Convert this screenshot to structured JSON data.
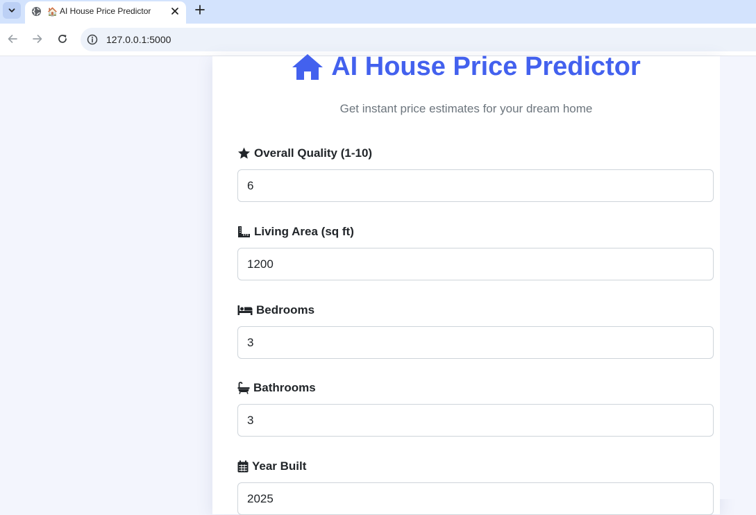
{
  "browser": {
    "tab": {
      "emoji": "🏠",
      "title": "AI House Price Predictor"
    },
    "url": "127.0.0.1:5000"
  },
  "header": {
    "icon": "home-icon",
    "title": "AI House Price Predictor",
    "subtitle": "Get instant price estimates for your dream home",
    "accent_color": "#4361ee"
  },
  "fields": [
    {
      "icon": "star-icon",
      "label": "Overall Quality (1-10)",
      "value": "6"
    },
    {
      "icon": "ruler-icon",
      "label": "Living Area (sq ft)",
      "value": "1200"
    },
    {
      "icon": "bed-icon",
      "label": "Bedrooms",
      "value": "3"
    },
    {
      "icon": "bath-icon",
      "label": "Bathrooms",
      "value": "3"
    },
    {
      "icon": "calendar-icon",
      "label": "Year Built",
      "value": "2025"
    }
  ]
}
